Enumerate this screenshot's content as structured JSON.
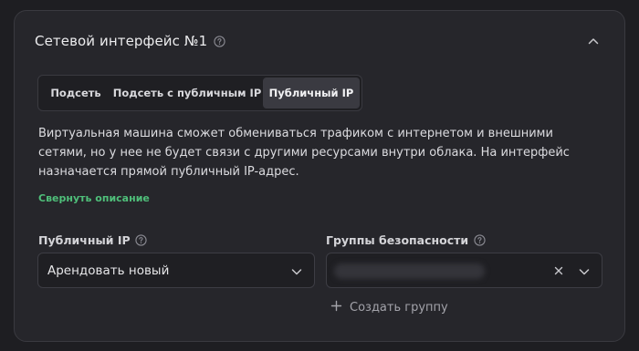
{
  "card": {
    "title": "Сетевой интерфейс №1"
  },
  "tabs": [
    {
      "label": "Подсеть",
      "selected": false
    },
    {
      "label": "Подсеть с публичным IP",
      "selected": false
    },
    {
      "label": "Публичный IP",
      "selected": true
    }
  ],
  "description": "Виртуальная машина сможет обмениваться трафиком с интернетом и внешними сетями, но у нее не будет связи с другими ресурсами внутри облака. На интерфейс назначается прямой публичный IP-адрес.",
  "collapse_description": "Свернуть описание",
  "public_ip": {
    "label": "Публичный IP",
    "value": "Арендовать новый"
  },
  "security_groups": {
    "label": "Группы безопасности",
    "value": ""
  },
  "create_group": "Создать группу",
  "colors": {
    "accent_green": "#4fbf7a",
    "card_bg": "#26262b",
    "page_bg": "#1e1e22",
    "selected_tab_bg": "#3a3a41"
  },
  "icons": {
    "help": "question-circle-icon",
    "collapse": "chevron-up-icon",
    "dropdown": "chevron-down-icon",
    "clear": "close-icon",
    "add": "plus-icon"
  }
}
